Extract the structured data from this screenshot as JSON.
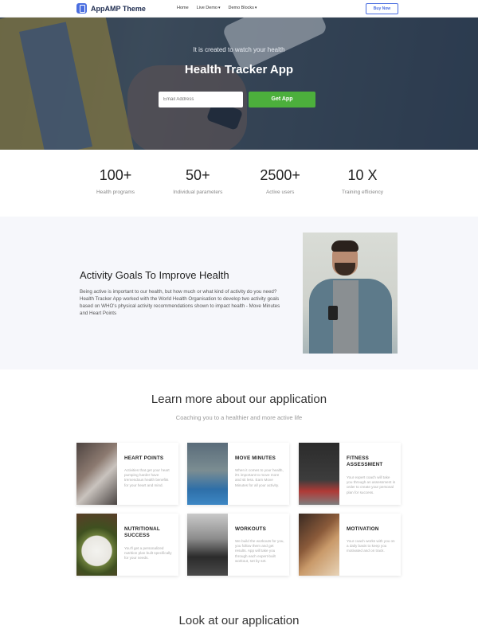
{
  "nav": {
    "brand": "AppAMP Theme",
    "items": [
      {
        "label": "Home",
        "caret": ""
      },
      {
        "label": "Live Demo",
        "caret": "▾"
      },
      {
        "label": "Demo Blocks",
        "caret": "▾"
      }
    ],
    "buy_label": "Buy Now",
    "accent": "#4a6ee0"
  },
  "hero": {
    "subtitle": "It is created to watch your health",
    "title": "Health Tracker App",
    "email_placeholder": "Email Address",
    "button_label": "Get App",
    "button_color": "#4caf3c"
  },
  "stats": [
    {
      "value": "100+",
      "label": "Health programs"
    },
    {
      "value": "50+",
      "label": "Individual parameters"
    },
    {
      "value": "2500+",
      "label": "Active users"
    },
    {
      "value": "10 X",
      "label": "Training efficiency"
    }
  ],
  "activity": {
    "title": "Activity Goals To Improve Health",
    "text": "Being active is important to our health, but how much or what kind of activity do you need? Health Tracker App worked with the World Health Organisation to develop two activity goals based on WHO's physical activity recommendations shown to impact health - Move Minutes and Heart Points"
  },
  "learn": {
    "title": "Learn more about our application",
    "subtitle": "Coaching you to a healthier and more active life",
    "cards": [
      {
        "title": "HEART POINTS",
        "text": "Activities that get your heart pumping harder have tremendous health benefits for your heart and mind."
      },
      {
        "title": "MOVE MINUTES",
        "text": "When it comes to your health, it's important to move more and sit less. Earn Move Minutes for all your activity."
      },
      {
        "title": "FITNESS ASSESSMENT",
        "text": "Your expert coach will take you through an assessment in order to create your personal plan for success."
      },
      {
        "title": "NUTRITIONAL SUCCESS",
        "text": "You'll get a personalized nutrition plan built specifically for your needs."
      },
      {
        "title": "WORKOUTS",
        "text": "We build the workouts for you, you follow them and get results. App will take you through each expert-built workout, set by set."
      },
      {
        "title": "MOTIVATION",
        "text": "Your coach works with you on a daily basis to keep you motivated and on track."
      }
    ]
  },
  "look": {
    "title": "Look at our application"
  }
}
